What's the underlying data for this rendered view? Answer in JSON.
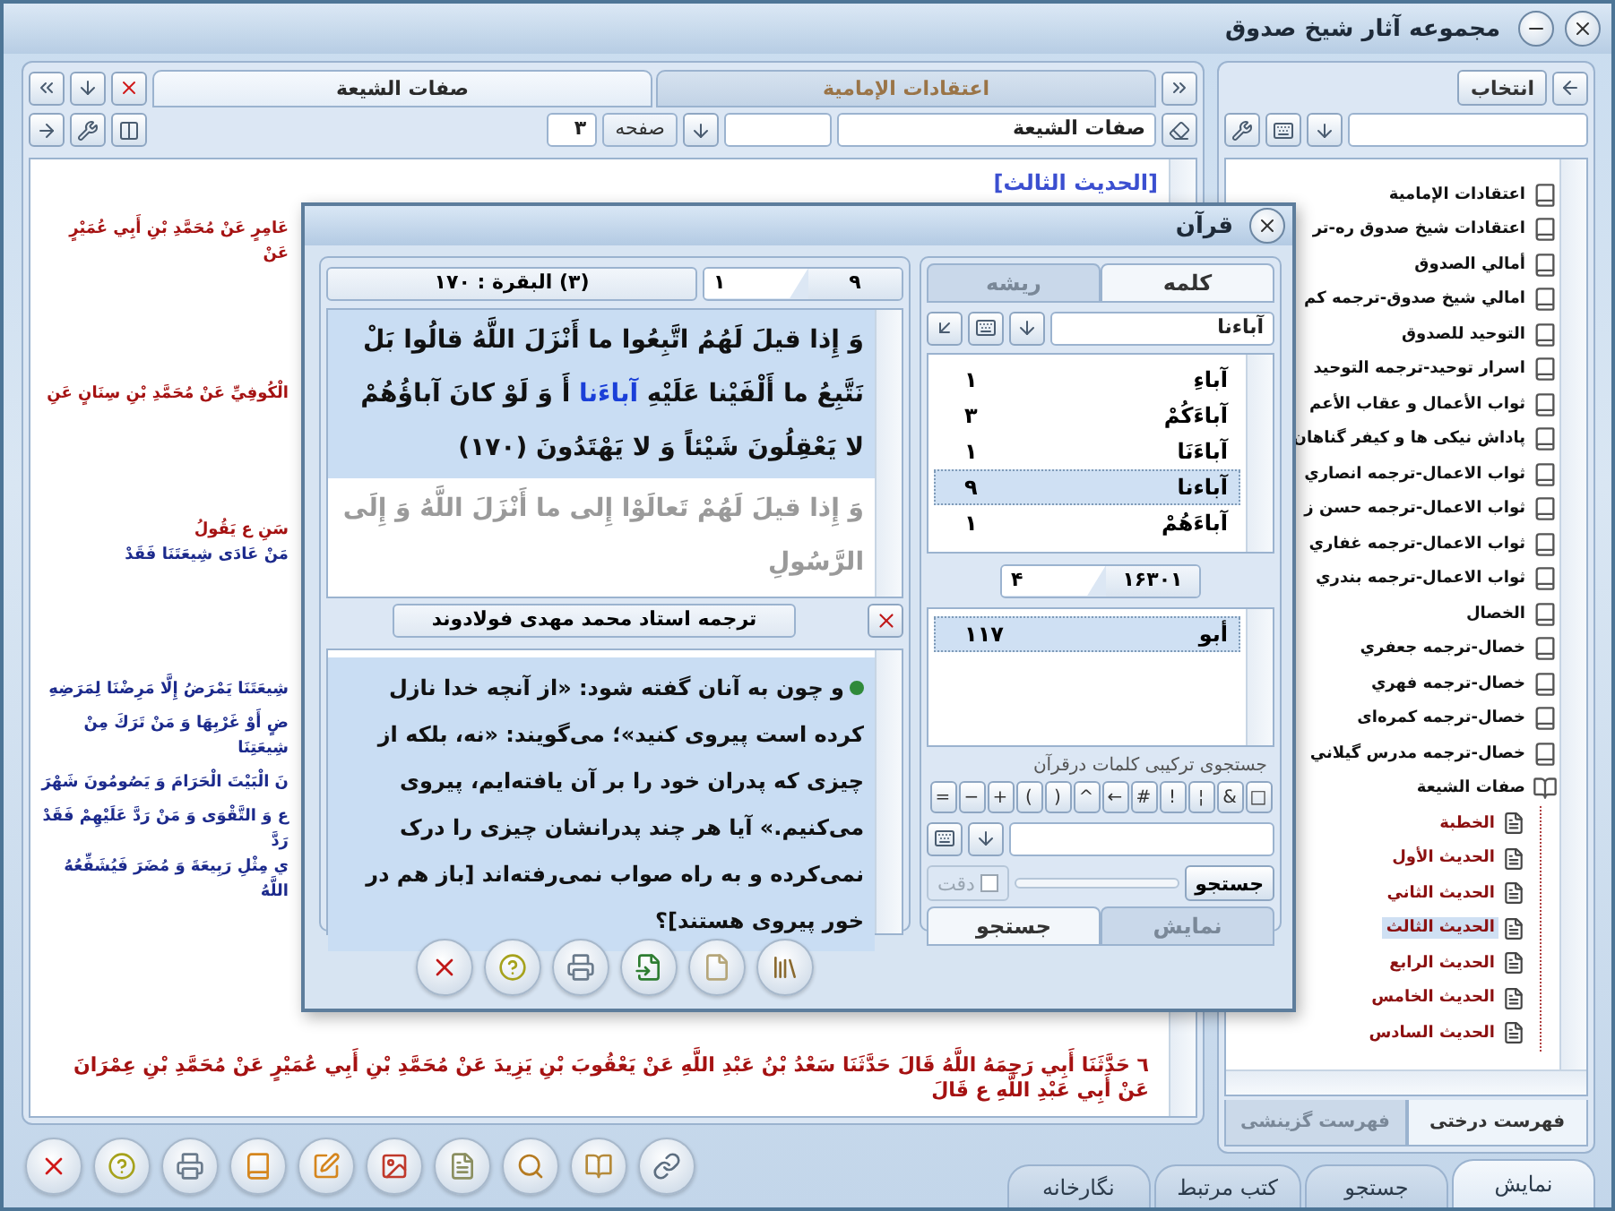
{
  "window": {
    "title": "مجموعه آثار شیخ صدوق"
  },
  "document": {
    "tabs": [
      {
        "label": "اعتقادات الإمامية",
        "selected": false
      },
      {
        "label": "صفات الشيعة",
        "selected": true
      }
    ],
    "page_field": {
      "value": "۳"
    },
    "page_label": "صفحه",
    "book_field": {
      "value": "صفات الشيعة"
    },
    "heading": "[الحديث الثالث]",
    "lines": [
      {
        "segments": [
          {
            "kind": "sanad",
            "text": "عَامِرٍ عَنْ مُحَمَّدِ بْنِ أَبِي عُمَيْرٍ عَنْ"
          }
        ]
      },
      {
        "segments": [
          {
            "kind": "sanad",
            "text": "الْكُوفِيِّ عَنْ مُحَمَّدِ بْنِ سِنَانٍ عَنِ"
          }
        ]
      },
      {
        "segments": [
          {
            "kind": "sanad",
            "text": "سَنِ ع يَقُولُ"
          },
          {
            "kind": "matn",
            "text": "مَنْ عَادَى شِيعَتَنَا فَقَدْ"
          }
        ]
      },
      {
        "segments": [
          {
            "kind": "matn",
            "text": "شِيعَتَنَا يَمْرَضُ إِلَّا مَرِضْنَا لِمَرَضِهِ"
          }
        ]
      },
      {
        "segments": [
          {
            "kind": "matn",
            "text": "ضٍ أَوْ غَرْبِهَا وَ مَنْ تَرَكَ مِنْ شِيعَتِنَا"
          }
        ]
      },
      {
        "segments": [
          {
            "kind": "matn",
            "text": "نَ الْبَيْتَ الْحَرَامَ وَ يَصُومُونَ شَهْرَ"
          }
        ]
      },
      {
        "segments": [
          {
            "kind": "matn",
            "text": "ع وَ التَّقْوَى وَ مَنْ رَدَّ عَلَيْهِمْ فَقَدْ رَدَّ"
          }
        ]
      },
      {
        "segments": [
          {
            "kind": "matn",
            "text": "ي مِثْلِ رَبِيعَةَ وَ مُضَرَ فَيُشَفِّعُهُ اللَّهُ"
          }
        ]
      },
      {
        "segments": [
          {
            "kind": "sanad",
            "text": "٦ حَدَّثَنَا أَبِي رَحِمَهُ اللَّهُ قَالَ حَدَّثَنَا سَعْدُ بْنُ عَبْدِ اللَّهِ عَنْ يَعْقُوبَ بْنِ يَزِيدَ عَنْ مُحَمَّدِ بْنِ أَبِي عُمَيْرٍ عَنْ مُحَمَّدِ بْنِ عِمْرَانَ عَنْ أَبِي عَبْدِ اللَّهِ ع قَالَ"
          }
        ]
      }
    ]
  },
  "tree": {
    "select_button": "انتخاب",
    "items": [
      {
        "label": "اعتقادات الإمامية",
        "kind": "book",
        "selected": false
      },
      {
        "label": "اعتقادات شيخ صدوق ره-تر",
        "kind": "book",
        "selected": false
      },
      {
        "label": "أمالي الصدوق",
        "kind": "book",
        "selected": false
      },
      {
        "label": "امالي شيخ صدوق-ترجمه كم",
        "kind": "book",
        "selected": false
      },
      {
        "label": "التوحيد للصدوق",
        "kind": "book",
        "selected": false
      },
      {
        "label": "اسرار توحيد-ترجمه التوحيد",
        "kind": "book",
        "selected": false
      },
      {
        "label": "ثواب الأعمال و عقاب الأعم",
        "kind": "book",
        "selected": false
      },
      {
        "label": "پاداش نيكی ها و كيفر گناهان",
        "kind": "book",
        "selected": false
      },
      {
        "label": "ثواب الاعمال-ترجمه انصاري",
        "kind": "book",
        "selected": false
      },
      {
        "label": "ثواب الاعمال-ترجمه حسن ز",
        "kind": "book",
        "selected": false
      },
      {
        "label": "ثواب الاعمال-ترجمه غفاري",
        "kind": "book",
        "selected": false
      },
      {
        "label": "ثواب الاعمال-ترجمه بندري",
        "kind": "book",
        "selected": false
      },
      {
        "label": "الخصال",
        "kind": "book",
        "selected": false
      },
      {
        "label": "خصال-ترجمه جعفري",
        "kind": "book",
        "selected": false
      },
      {
        "label": "خصال-ترجمه فهري",
        "kind": "book",
        "selected": false
      },
      {
        "label": "خصال-ترجمه كمره‌ای",
        "kind": "book",
        "selected": false
      },
      {
        "label": "خصال-ترجمه مدرس گيلاني",
        "kind": "book",
        "selected": false
      },
      {
        "label": "صفات الشيعة",
        "kind": "book",
        "selected": false,
        "expanded": true,
        "children": [
          {
            "label": "الخطبة",
            "kind": "chapter",
            "selected": false
          },
          {
            "label": "الحديث الأول",
            "kind": "chapter",
            "selected": false
          },
          {
            "label": "الحديث الثاني",
            "kind": "chapter",
            "selected": false
          },
          {
            "label": "الحديث الثالث",
            "kind": "chapter",
            "selected": true
          },
          {
            "label": "الحديث الرابع",
            "kind": "chapter",
            "selected": false
          },
          {
            "label": "الحديث الخامس",
            "kind": "chapter",
            "selected": false
          },
          {
            "label": "الحديث السادس",
            "kind": "chapter",
            "selected": false
          }
        ]
      }
    ],
    "tabs": [
      {
        "label": "فهرست درختی",
        "selected": true
      },
      {
        "label": "فهرست گزینشی",
        "selected": false
      }
    ]
  },
  "main_tabs": [
    {
      "label": "نمایش",
      "selected": true
    },
    {
      "label": "جستجو",
      "selected": false
    },
    {
      "label": "کتب مرتبط",
      "selected": false
    },
    {
      "label": "نگارخانه",
      "selected": false
    }
  ],
  "quran_dialog": {
    "title": "قرآن",
    "reference": "(۳) البقرة : ۱۷۰",
    "verse_pager": {
      "current": "۱",
      "total": "۹"
    },
    "verses": [
      {
        "selected": true,
        "segments": [
          {
            "text": "وَ إِذا قيلَ لَهُمُ اتَّبِعُوا ما أَنْزَلَ اللَّهُ قالُوا بَلْ نَتَّبِعُ ما أَلْفَيْنا عَلَيْهِ",
            "highlighted": false
          },
          {
            "text": "آباءَنا",
            "highlighted": true
          },
          {
            "text": "أَ وَ لَوْ كانَ آباؤُهُمْ لا يَعْقِلُونَ شَيْئاً وَ لا يَهْتَدُونَ (۱۷۰)",
            "highlighted": false
          }
        ]
      },
      {
        "selected": false,
        "segments": [
          {
            "text": "وَ إِذا قيلَ لَهُمْ تَعالَوْا إِلى ما أَنْزَلَ اللَّهُ وَ إِلَى الرَّسُولِ",
            "highlighted": false
          }
        ]
      }
    ],
    "translation": {
      "title": "ترجمه استاد محمد مهدی فولادوند",
      "text": "و چون به آنان گفته شود: «از آنچه خدا نازل کرده است پیروی کنید»؛ می‌گویند: «نه، بلکه از چیزی که پدران خود را بر آن یافته‌ایم، پیروی می‌کنیم.» آیا هر چند پدرانشان چیزی را درک نمی‌کرده و به راه صواب نمی‌رفته‌اند [باز هم در خور پیروی هستند]؟"
    },
    "word_tabs": [
      {
        "label": "کلمه",
        "selected": true
      },
      {
        "label": "ریشه",
        "selected": false
      }
    ],
    "word_field": {
      "value": "آباءنا"
    },
    "words": [
      {
        "word": "آباءِ",
        "count": "۱",
        "selected": false
      },
      {
        "word": "آباءَكُمْ",
        "count": "۳",
        "selected": false
      },
      {
        "word": "آباءَنَا",
        "count": "۱",
        "selected": false
      },
      {
        "word": "آباءنا",
        "count": "۹",
        "selected": true
      },
      {
        "word": "آباءَهُمْ",
        "count": "۱",
        "selected": false
      }
    ],
    "word_pager": {
      "current": "۴",
      "total": "۱۶۳۰۱"
    },
    "roots": [
      {
        "word": "أبو",
        "count": "۱۱۷",
        "selected": true
      }
    ],
    "combo_search": {
      "title": "جستجوی ترکیبی کلمات درقرآن",
      "operators": [
        "□",
        "&",
        "¦",
        "!",
        "#",
        "←",
        "^",
        ")",
        "(",
        "+",
        "−",
        "="
      ],
      "search_button": "جستجو",
      "precise": {
        "label": "دقت",
        "checked": false,
        "disabled": true
      }
    },
    "bottom_tabs": [
      {
        "label": "نمایش",
        "selected": false
      },
      {
        "label": "جستجو",
        "selected": true
      }
    ]
  }
}
